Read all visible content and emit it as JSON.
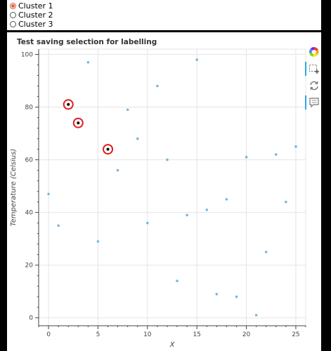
{
  "radio_group": {
    "options": [
      {
        "label": "Cluster 1",
        "checked": true
      },
      {
        "label": "Cluster 2",
        "checked": false
      },
      {
        "label": "Cluster 3",
        "checked": false
      }
    ]
  },
  "toolbar": {
    "tools": [
      {
        "name": "bokeh-logo-icon",
        "active": false
      },
      {
        "name": "box-select-icon",
        "active": true
      },
      {
        "name": "reset-icon",
        "active": false
      },
      {
        "name": "hover-icon",
        "active": true
      }
    ]
  },
  "chart_data": {
    "type": "scatter",
    "title": "Test saving selection for labelling",
    "xlabel": "X",
    "ylabel": "Temperature (Celsius)",
    "xlim": [
      -1,
      26
    ],
    "ylim": [
      -3,
      102
    ],
    "xticks": [
      0,
      5,
      10,
      15,
      20,
      25
    ],
    "yticks": [
      0,
      20,
      40,
      60,
      80,
      100
    ],
    "grid": true,
    "point_color": "#6baed6",
    "selection_color": "#e31a1c",
    "points": [
      {
        "x": 0,
        "y": 47
      },
      {
        "x": 1,
        "y": 35
      },
      {
        "x": 2,
        "y": 81
      },
      {
        "x": 3,
        "y": 74
      },
      {
        "x": 4,
        "y": 97
      },
      {
        "x": 5,
        "y": 29
      },
      {
        "x": 6,
        "y": 64
      },
      {
        "x": 7,
        "y": 56
      },
      {
        "x": 8,
        "y": 79
      },
      {
        "x": 9,
        "y": 68
      },
      {
        "x": 10,
        "y": 36
      },
      {
        "x": 11,
        "y": 88
      },
      {
        "x": 12,
        "y": 60
      },
      {
        "x": 13,
        "y": 14
      },
      {
        "x": 14,
        "y": 39
      },
      {
        "x": 15,
        "y": 98
      },
      {
        "x": 16,
        "y": 41
      },
      {
        "x": 17,
        "y": 9
      },
      {
        "x": 18,
        "y": 45
      },
      {
        "x": 19,
        "y": 8
      },
      {
        "x": 20,
        "y": 61
      },
      {
        "x": 21,
        "y": 1
      },
      {
        "x": 22,
        "y": 25
      },
      {
        "x": 23,
        "y": 62
      },
      {
        "x": 24,
        "y": 44
      },
      {
        "x": 25,
        "y": 65
      }
    ],
    "selected": [
      {
        "x": 2,
        "y": 81
      },
      {
        "x": 3,
        "y": 74
      },
      {
        "x": 6,
        "y": 64
      }
    ]
  }
}
